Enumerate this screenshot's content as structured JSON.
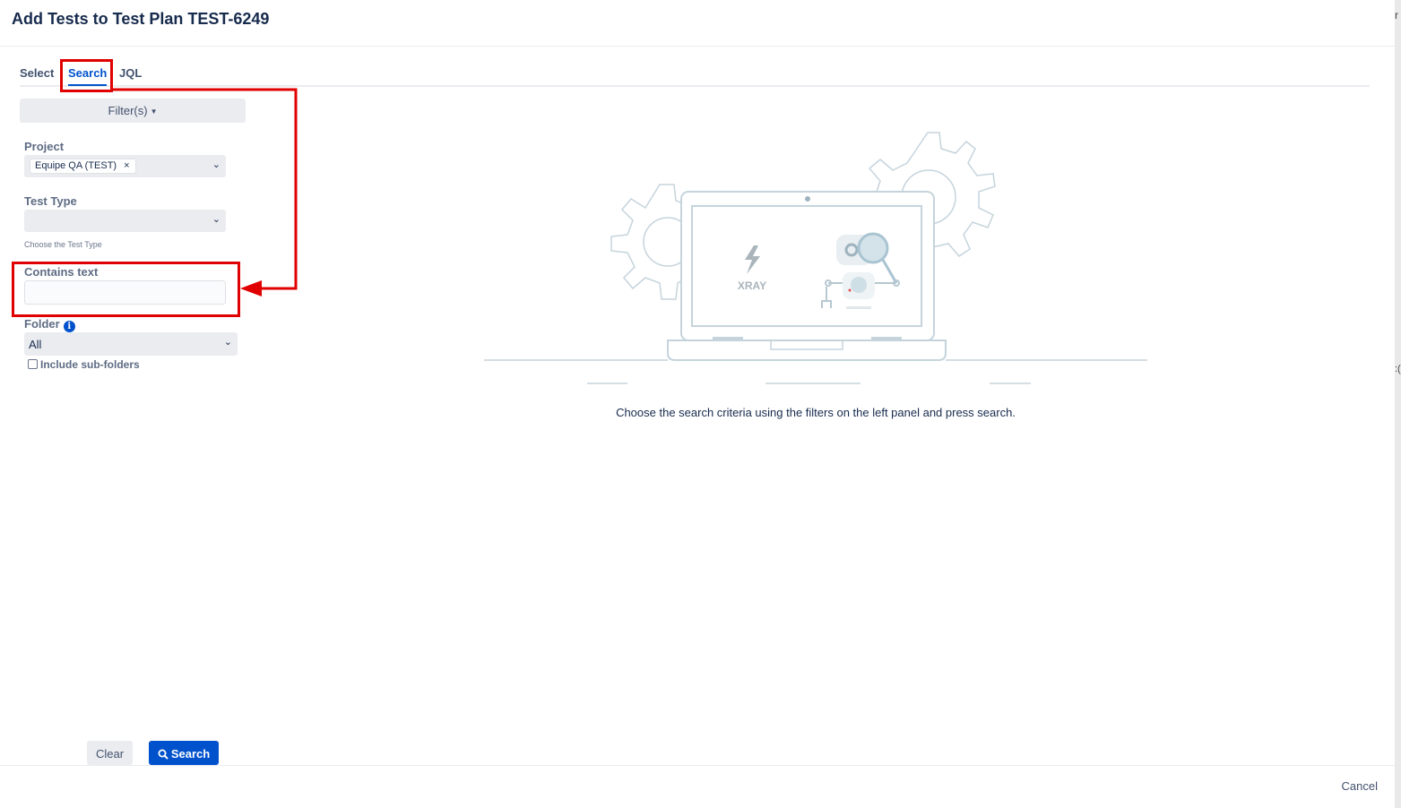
{
  "dialog": {
    "title": "Add Tests to Test Plan TEST-6249"
  },
  "tabs": [
    {
      "label": "Select"
    },
    {
      "label": "Search"
    },
    {
      "label": "JQL"
    }
  ],
  "active_tab": "Search",
  "filters": {
    "button_label": "Filter(s)",
    "project": {
      "label": "Project",
      "selected_chip": "Equipe QA (TEST)",
      "remove_glyph": "×"
    },
    "test_type": {
      "label": "Test Type",
      "value": "",
      "hint": "Choose the Test Type"
    },
    "contains_text": {
      "label": "Contains text",
      "value": ""
    },
    "folder": {
      "label": "Folder",
      "info_glyph": "i",
      "value": "All",
      "include_subfolders_label": "Include sub-folders",
      "include_subfolders_checked": false
    }
  },
  "illustration": {
    "logo_text": "XRAY"
  },
  "empty_state": {
    "message": "Choose the search criteria using the filters on the left panel and press search."
  },
  "actions": {
    "clear_label": "Clear",
    "search_label": "Search"
  },
  "footer": {
    "cancel_label": "Cancel"
  },
  "right_edge": {
    "fragment_top": "r",
    "fragment_mid": ":("
  },
  "colors": {
    "primary": "#0052cc",
    "annotation_red": "#e00000",
    "illustration_stroke": "#c5d4dc"
  }
}
